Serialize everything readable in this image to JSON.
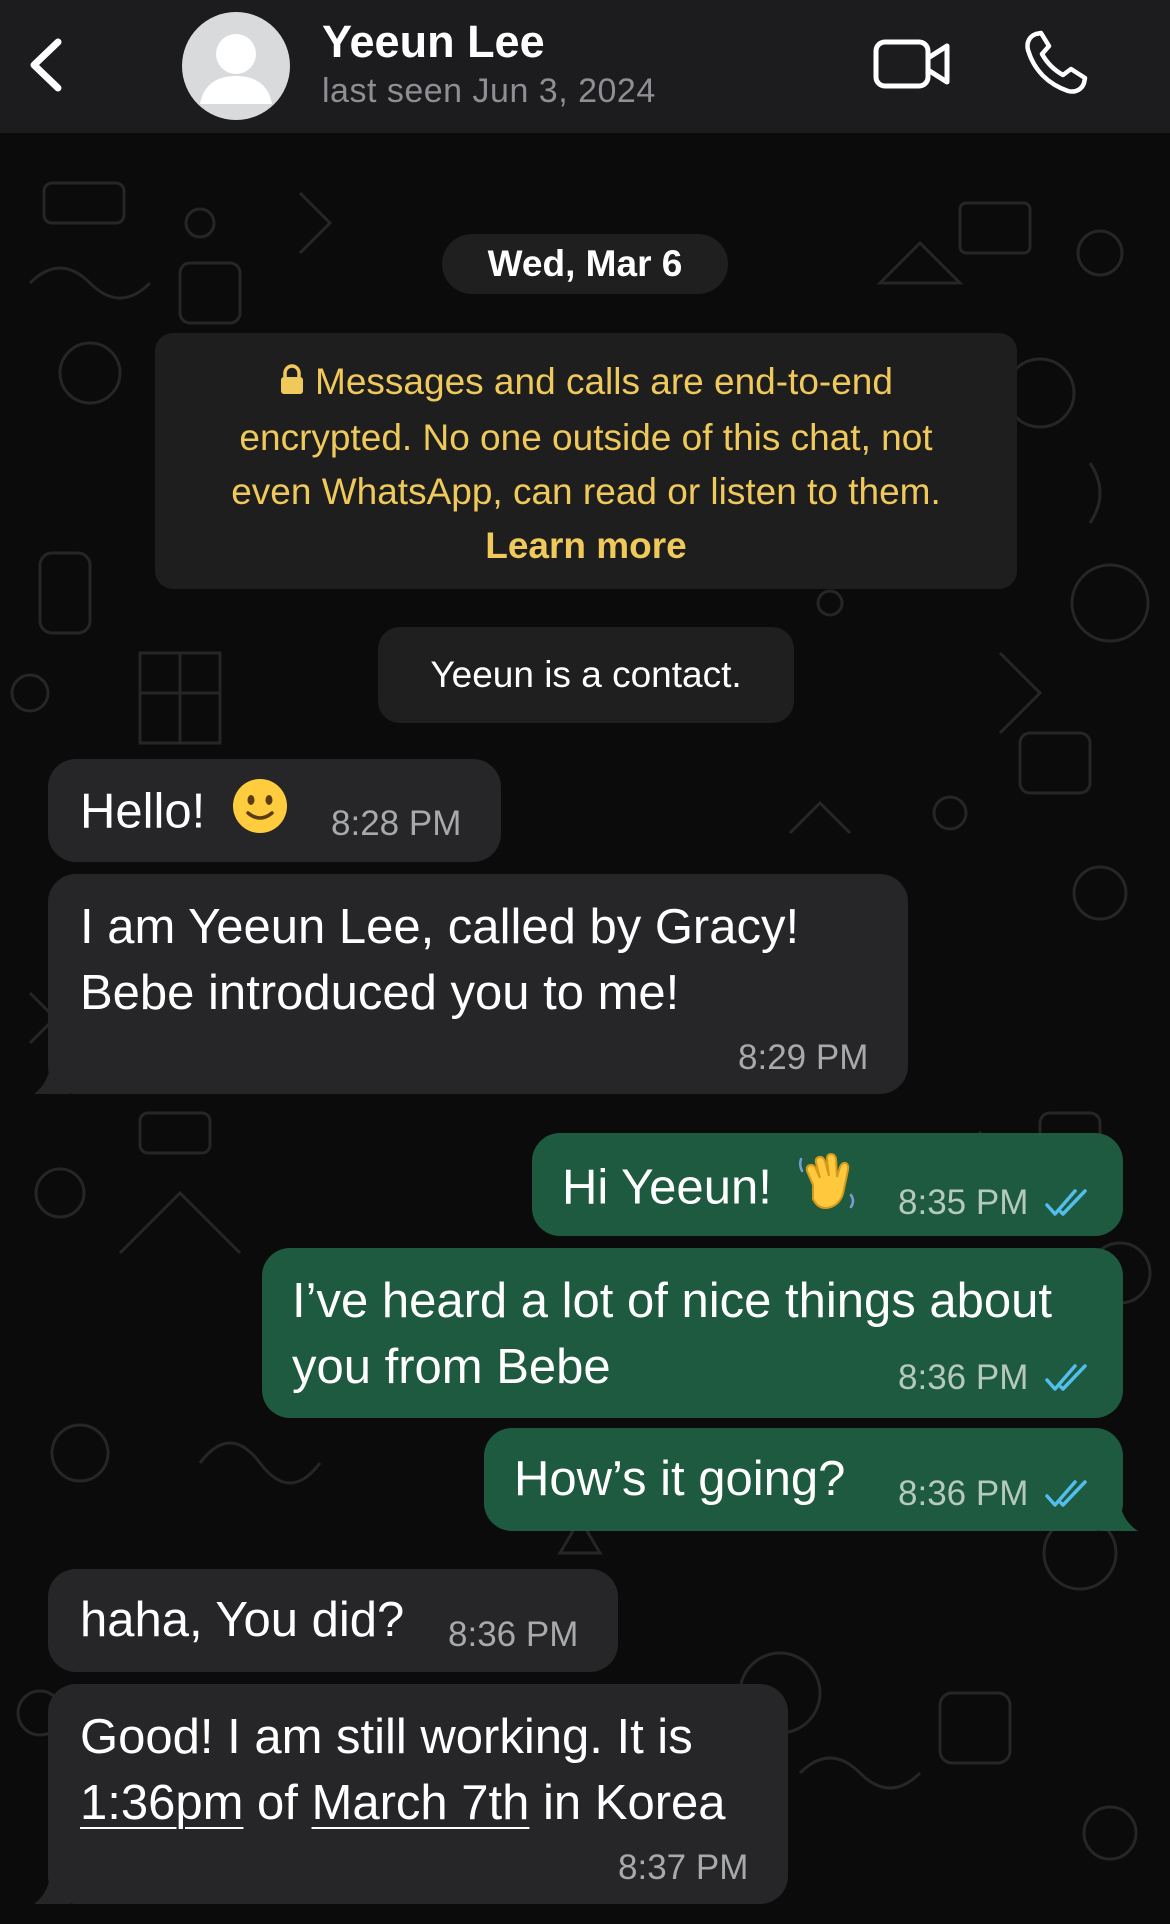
{
  "header": {
    "contact_name": "Yeeun Lee",
    "last_seen": "last seen Jun 3, 2024"
  },
  "chat": {
    "date_label": "Wed, Mar 6",
    "encryption_notice": {
      "line1": "Messages and calls are end-to-end",
      "line2": "encrypted. No one outside of this chat, not",
      "line3": "even WhatsApp, can read or listen to them.",
      "learn_more": "Learn more"
    },
    "contact_notice": "Yeeun is a contact.",
    "messages": [
      {
        "direction": "incoming",
        "text": "Hello!",
        "emoji": "slightly-smiling-face",
        "time": "8:28 PM"
      },
      {
        "direction": "incoming",
        "line1": "I am Yeeun Lee, called by Gracy!",
        "line2": "Bebe introduced you to me!",
        "time": "8:29 PM"
      },
      {
        "direction": "outgoing",
        "text": "Hi Yeeun!",
        "emoji": "waving-hand",
        "time": "8:35 PM",
        "status": "read"
      },
      {
        "direction": "outgoing",
        "line1": "I’ve heard a lot of nice things about",
        "line2": "you from Bebe",
        "time": "8:36 PM",
        "status": "read"
      },
      {
        "direction": "outgoing",
        "text": "How’s it going?",
        "time": "8:36 PM",
        "status": "read"
      },
      {
        "direction": "incoming",
        "text": "haha, You did?",
        "time": "8:36 PM"
      },
      {
        "direction": "incoming",
        "line1_a": "Good! I am still working. It is",
        "line2_time": "1:36pm",
        "line2_of": " of ",
        "line2_date": "March 7th",
        "line2_rest": " in Korea",
        "time": "8:37 PM"
      }
    ]
  },
  "colors": {
    "header_bg": "#1c1c1e",
    "incoming_bubble": "#262628",
    "outgoing_bubble": "#1d5a3f",
    "notice_text": "#f0c95b",
    "read_ticks": "#53bdeb"
  }
}
